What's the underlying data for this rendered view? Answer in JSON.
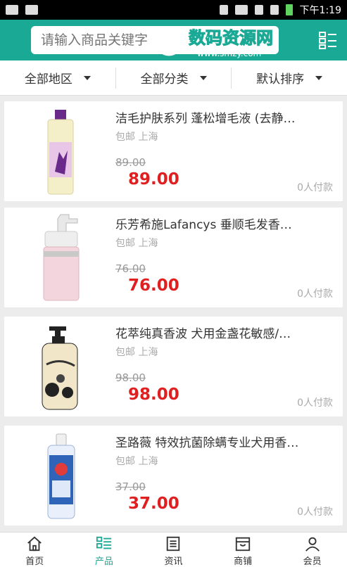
{
  "status_bar": {
    "time": "下午1:19"
  },
  "search": {
    "placeholder": "请输入商品关键字"
  },
  "filters": [
    {
      "label": "全部地区"
    },
    {
      "label": "全部分类"
    },
    {
      "label": "默认排序"
    }
  ],
  "products": [
    {
      "title": "洁毛护肤系列 蓬松增毛液 (去静…",
      "ship": "包邮 上海",
      "old_price": "89.00",
      "price": "89.00",
      "sold": "0人付款",
      "image": "purple-bottle"
    },
    {
      "title": "乐芳希施Lafancys 垂顺毛发香…",
      "ship": "包邮 上海",
      "old_price": "76.00",
      "price": "76.00",
      "sold": "0人付款",
      "image": "pink-pump-bottle"
    },
    {
      "title": "花萃纯真香波 犬用金盏花敏感/…",
      "ship": "包邮 上海",
      "old_price": "98.00",
      "price": "98.00",
      "sold": "0人付款",
      "image": "black-floral-bottle"
    },
    {
      "title": "圣路薇 特效抗菌除螨专业犬用香…",
      "ship": "包邮 上海",
      "old_price": "37.00",
      "price": "37.00",
      "sold": "0人付款",
      "image": "blue-shampoo-bottle"
    }
  ],
  "bottom_nav": [
    {
      "label": "首页",
      "icon": "home-icon",
      "active": false
    },
    {
      "label": "产品",
      "icon": "list-icon",
      "active": true
    },
    {
      "label": "资讯",
      "icon": "news-icon",
      "active": false
    },
    {
      "label": "商铺",
      "icon": "shop-icon",
      "active": false
    },
    {
      "label": "会员",
      "icon": "user-icon",
      "active": false
    }
  ],
  "watermark": {
    "text": "数码资源网",
    "url": "www.smzy.com"
  },
  "colors": {
    "brand": "#1aa995",
    "price": "#e02020"
  }
}
